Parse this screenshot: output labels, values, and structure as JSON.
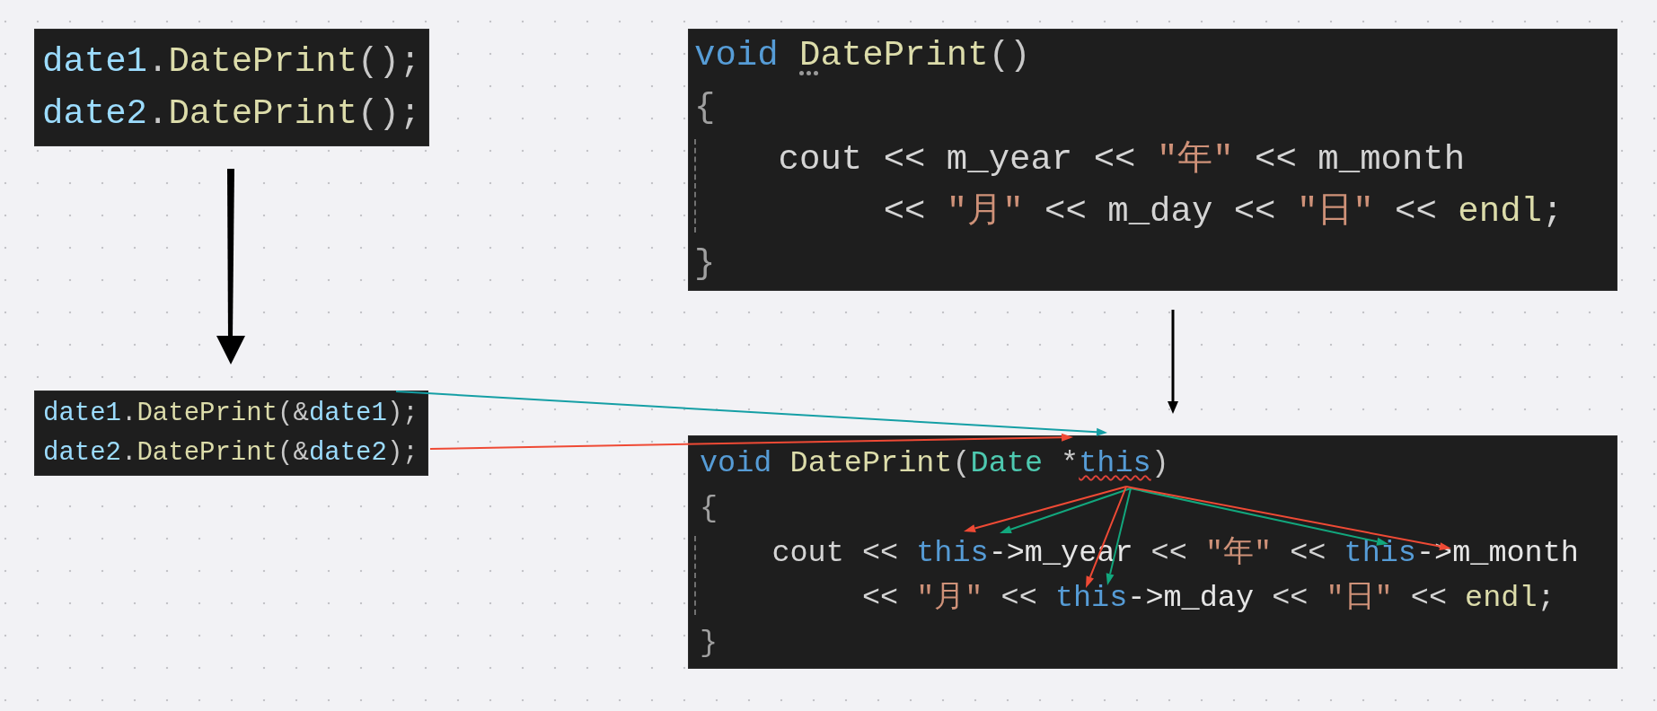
{
  "code_blocks": [
    {
      "lines": [
        {
          "kind": "head",
          "tokens": [
            {
              "kind": "variable",
              "text": "date1"
            },
            {
              "kind": "punct",
              "text": "."
            },
            {
              "kind": "function",
              "text": "DatePrint"
            },
            {
              "kind": "punct",
              "text": "();"
            }
          ]
        },
        {
          "kind": "head",
          "tokens": [
            {
              "kind": "variable",
              "text": "date2"
            },
            {
              "kind": "punct",
              "text": "."
            },
            {
              "kind": "function",
              "text": "DatePrint"
            },
            {
              "kind": "punct",
              "text": "();"
            }
          ]
        }
      ]
    },
    {
      "lines": [
        {
          "kind": "head",
          "tokens": [
            {
              "kind": "keyword",
              "text": "void "
            },
            {
              "kind": "function",
              "text": "DatePrint",
              "hint": true
            },
            {
              "kind": "punct",
              "text": "()"
            }
          ]
        },
        {
          "kind": "head",
          "tokens": [
            {
              "kind": "brace",
              "text": "{"
            }
          ]
        },
        {
          "kind": "body",
          "tokens": [
            {
              "kind": "plain",
              "text": "cout << m_year << "
            },
            {
              "kind": "string",
              "text": "\"年\""
            },
            {
              "kind": "plain",
              "text": " << m_month"
            }
          ]
        },
        {
          "kind": "continuation",
          "tokens": [
            {
              "kind": "plain",
              "text": "<< "
            },
            {
              "kind": "string",
              "text": "\"月\""
            },
            {
              "kind": "plain",
              "text": " << m_day << "
            },
            {
              "kind": "string",
              "text": "\"日\""
            },
            {
              "kind": "plain",
              "text": " << "
            },
            {
              "kind": "function",
              "text": "endl"
            },
            {
              "kind": "plain",
              "text": ";"
            }
          ]
        },
        {
          "kind": "head",
          "tokens": [
            {
              "kind": "brace",
              "text": "}"
            }
          ]
        }
      ]
    },
    {
      "lines": [
        {
          "kind": "head",
          "tokens": [
            {
              "kind": "variable",
              "text": "date1"
            },
            {
              "kind": "punct",
              "text": "."
            },
            {
              "kind": "function",
              "text": "DatePrint"
            },
            {
              "kind": "punct",
              "text": "(&"
            },
            {
              "kind": "variable",
              "text": "date1"
            },
            {
              "kind": "punct",
              "text": ");"
            }
          ]
        },
        {
          "kind": "head",
          "tokens": [
            {
              "kind": "variable",
              "text": "date2"
            },
            {
              "kind": "punct",
              "text": "."
            },
            {
              "kind": "function",
              "text": "DatePrint"
            },
            {
              "kind": "punct",
              "text": "(&"
            },
            {
              "kind": "variable",
              "text": "date2"
            },
            {
              "kind": "punct",
              "text": ");"
            }
          ]
        }
      ]
    },
    {
      "lines": [
        {
          "kind": "head",
          "tokens": [
            {
              "kind": "keyword",
              "text": "void "
            },
            {
              "kind": "function",
              "text": "DatePrint"
            },
            {
              "kind": "punct",
              "text": "("
            },
            {
              "kind": "type",
              "text": "Date"
            },
            {
              "kind": "punct",
              "text": " *"
            },
            {
              "kind": "keyword",
              "text": "this",
              "error": true
            },
            {
              "kind": "punct",
              "text": ")"
            }
          ]
        },
        {
          "kind": "head",
          "tokens": [
            {
              "kind": "brace",
              "text": "{"
            }
          ]
        },
        {
          "kind": "body",
          "tokens": [
            {
              "kind": "plain",
              "text": "cout << "
            },
            {
              "kind": "keyword",
              "text": "this"
            },
            {
              "kind": "member",
              "text": "->m_year"
            },
            {
              "kind": "plain",
              "text": " << "
            },
            {
              "kind": "string",
              "text": "\"年\""
            },
            {
              "kind": "plain",
              "text": " << "
            },
            {
              "kind": "keyword",
              "text": "this"
            },
            {
              "kind": "member",
              "text": "->m_month"
            }
          ]
        },
        {
          "kind": "continuation",
          "tokens": [
            {
              "kind": "plain",
              "text": "<< "
            },
            {
              "kind": "string",
              "text": "\"月\""
            },
            {
              "kind": "plain",
              "text": " << "
            },
            {
              "kind": "keyword",
              "text": "this"
            },
            {
              "kind": "member",
              "text": "->m_day"
            },
            {
              "kind": "plain",
              "text": " << "
            },
            {
              "kind": "string",
              "text": "\"日\""
            },
            {
              "kind": "plain",
              "text": " << "
            },
            {
              "kind": "function",
              "text": "endl"
            },
            {
              "kind": "plain",
              "text": ";"
            }
          ]
        },
        {
          "kind": "head",
          "tokens": [
            {
              "kind": "brace",
              "text": "}"
            }
          ]
        }
      ]
    }
  ]
}
